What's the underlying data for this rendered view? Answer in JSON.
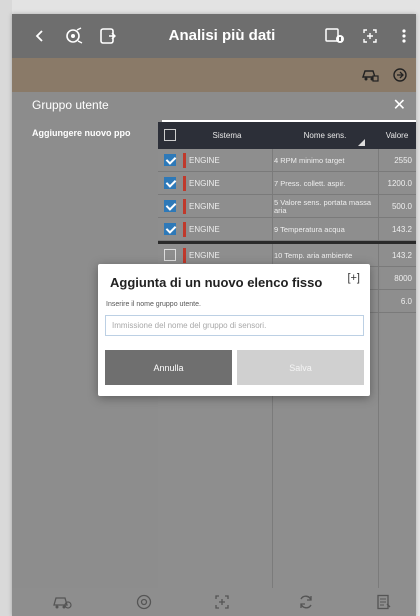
{
  "header": {
    "title": "Analisi più dati",
    "icons": [
      "back-icon",
      "settings-icon",
      "tablet-icon",
      "car-info-icon",
      "expand-icon",
      "more-icon"
    ]
  },
  "subbar": {
    "icons": [
      "car-add-icon",
      "refresh-icon"
    ]
  },
  "group": {
    "title": "Gruppo utente",
    "close_label": "✕",
    "add_new_group": "Aggiungere nuovo ppo"
  },
  "table": {
    "columns": [
      "Sistema",
      "Nome sens.",
      "Valore"
    ],
    "rows": [
      {
        "checked": true,
        "system": "ENGINE",
        "name": "4 RPM minimo target",
        "value": "2550"
      },
      {
        "checked": true,
        "system": "ENGINE",
        "name": "7 Press. collett. aspir.",
        "value": "1200.0"
      },
      {
        "checked": true,
        "system": "ENGINE",
        "name": "5 Valore sens. portata massa aria",
        "value": "500.0"
      },
      {
        "checked": true,
        "system": "ENGINE",
        "name": "9 Temperatura acqua",
        "value": "143.2"
      },
      {
        "checked": false,
        "system": "ENGINE",
        "name": "10 Temp. aria ambiente",
        "value": "143.2"
      },
      {
        "checked": false,
        "system": "",
        "name": "",
        "value": "8000"
      },
      {
        "checked": false,
        "system": "",
        "name": "",
        "value": "6.0"
      }
    ]
  },
  "modal": {
    "title": "Aggiunta di un nuovo elenco fisso",
    "icon": "[+]",
    "field_label": "Inserire il nome gruppo utente.",
    "placeholder": "Immissione del nome del gruppo di sensori.",
    "cancel_label": "Annulla",
    "save_label": "Salva"
  },
  "bottombar": {
    "icons": [
      "car-scan-icon",
      "record-icon",
      "fullscreen-icon",
      "sync-icon",
      "report-icon"
    ]
  },
  "colors": {
    "header_bg": "#6e6e6e",
    "table_header_bg": "#2c2f38",
    "checkbox_checked": "#2e79b8",
    "system_marker": "#c0392b",
    "cancel_button": "#6f6f6f",
    "save_button": "#d0d0d0"
  }
}
